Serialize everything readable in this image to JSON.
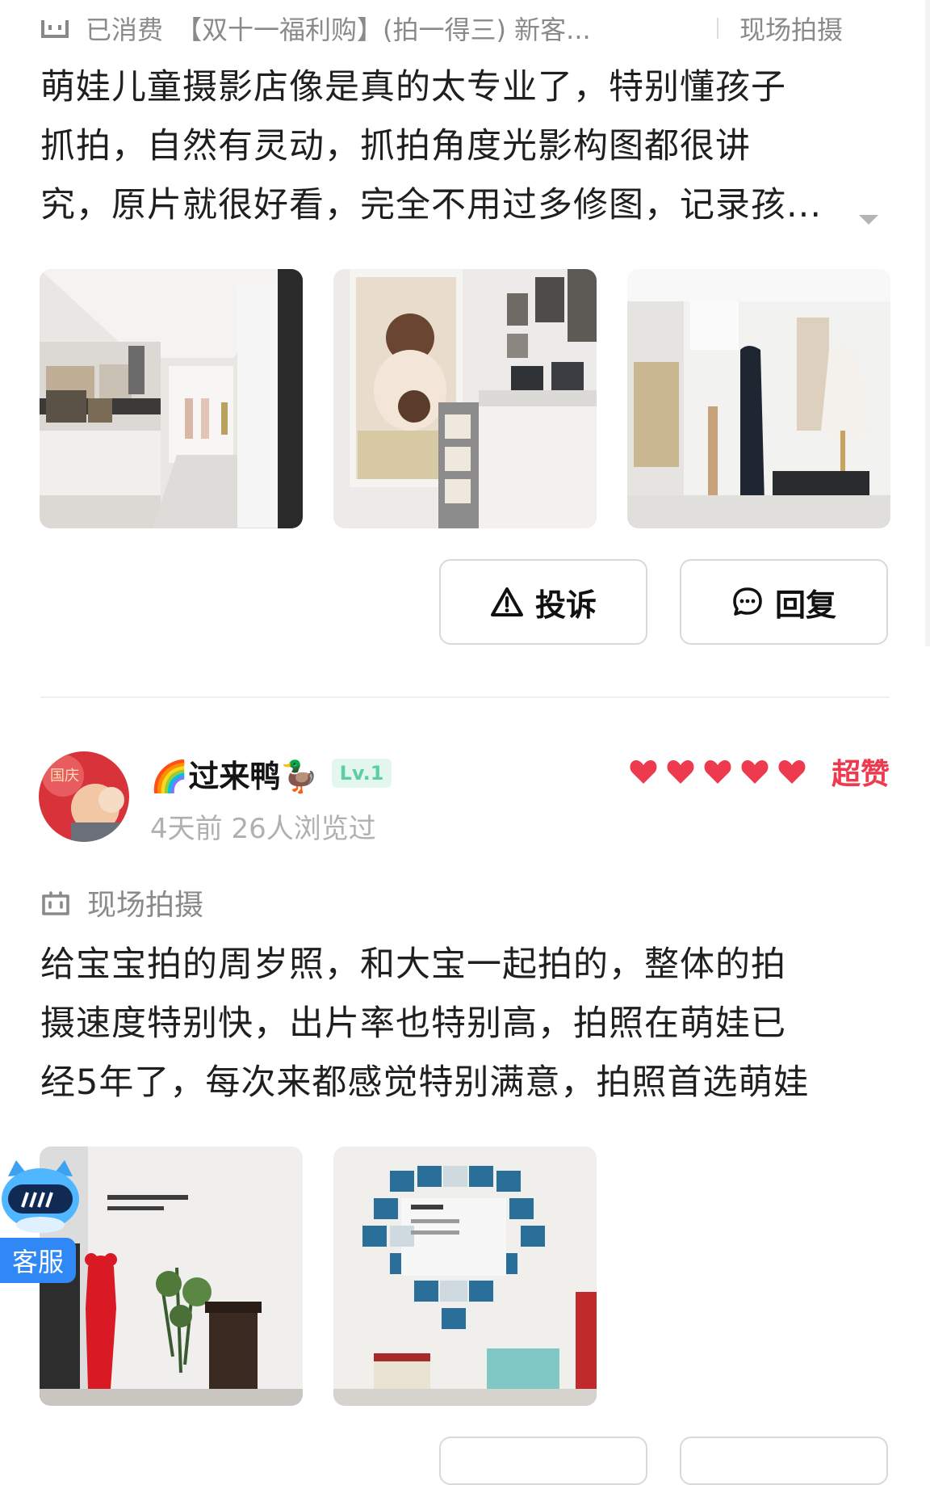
{
  "review1": {
    "tag_status": "已消费",
    "tag_product": "【双十一福利购】(拍一得三) 新客...",
    "tag_service": "现场拍摄",
    "text_lines": [
      "萌娃儿童摄影店像是真的太专业了，特别懂孩子",
      "抓拍，自然有灵动，抓拍角度光影构图都很讲",
      "究，原片就很好看，完全不用过多修图，记录孩..."
    ],
    "actions": {
      "complain": "投诉",
      "reply": "回复"
    }
  },
  "review2": {
    "username": "🌈过来鸭🦆",
    "level": "Lv.1",
    "meta": "4天前 26人浏览过",
    "rating_label": "超赞",
    "rating_hearts": 5,
    "tag_service": "现场拍摄",
    "text_lines": [
      "给宝宝拍的周岁照，和大宝一起拍的，整体的拍",
      "摄速度特别快，出片率也特别高，拍照在萌娃已",
      "经5年了，每次来都感觉特别满意，拍照首选萌娃"
    ]
  },
  "floating": {
    "customer_service": "客服"
  },
  "colors": {
    "accent_red": "#ee3a4f",
    "level_green": "#5ccfa0",
    "service_blue": "#2f88f5"
  }
}
